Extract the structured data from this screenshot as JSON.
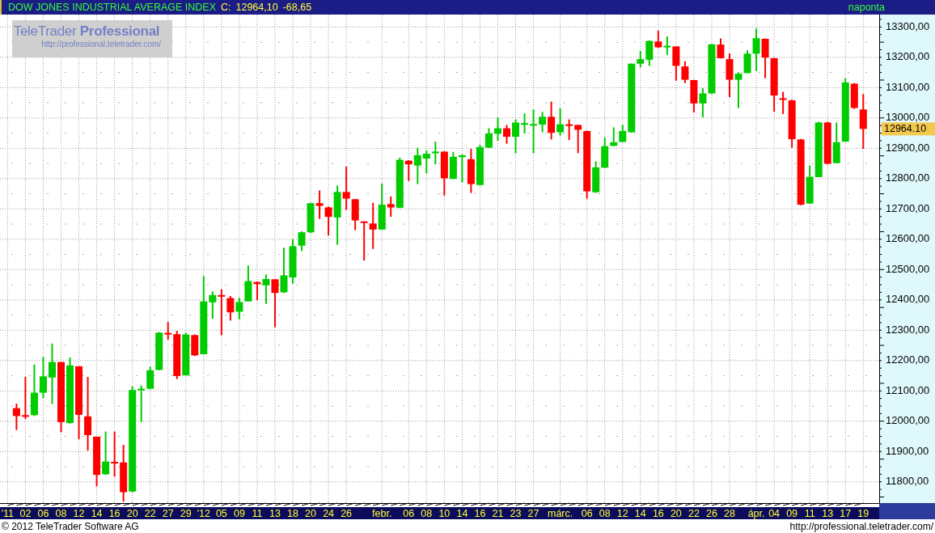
{
  "title_bar": {
    "title": "DOW JONES INDUSTRIAL AVERAGE INDEX",
    "quote_label": "C:",
    "close": "12964,10",
    "change": "-68,65",
    "interval": "naponta"
  },
  "logo": {
    "name": "TeleTrader **Professional**",
    "url": "http://professional.teletrader.com/"
  },
  "chart": {
    "last_price_label": "12964.10",
    "chart_data": {
      "type": "candlestick",
      "grid": true,
      "ylim": [
        11730,
        13341
      ],
      "categories": [
        "'11",
        null,
        "02",
        null,
        "06",
        null,
        "08",
        null,
        "12",
        null,
        "14",
        null,
        "16",
        null,
        "20",
        null,
        "22",
        null,
        "27",
        null,
        "29",
        null,
        "'12",
        null,
        "05",
        null,
        "09",
        null,
        "11",
        null,
        "13",
        null,
        "18",
        null,
        "20",
        null,
        "24",
        null,
        "26",
        null,
        null,
        null,
        "febr.",
        null,
        null,
        "06",
        null,
        "08",
        null,
        "10",
        null,
        "14",
        null,
        "16",
        null,
        "21",
        null,
        "23",
        null,
        "27",
        null,
        null,
        "márc.",
        null,
        null,
        "06",
        null,
        "08",
        null,
        "12",
        null,
        "14",
        null,
        "16",
        null,
        "20",
        null,
        "22",
        null,
        "26",
        null,
        "28",
        null,
        null,
        "ápr.",
        null,
        "04",
        null,
        "09",
        null,
        "11",
        null,
        "13",
        null,
        "17",
        null,
        "19"
      ],
      "yticks": [
        {
          "value": 13300,
          "label": "13300,00"
        },
        {
          "value": 13200,
          "label": "13200,00"
        },
        {
          "value": 13100,
          "label": "13100,00"
        },
        {
          "value": 13000,
          "label": "13000,00"
        },
        {
          "value": 12900,
          "label": "12900,00"
        },
        {
          "value": 12800,
          "label": "12800,00"
        },
        {
          "value": 12700,
          "label": "12700,00"
        },
        {
          "value": 12600,
          "label": "12600,00"
        },
        {
          "value": 12500,
          "label": "12500,00"
        },
        {
          "value": 12400,
          "label": "12400,00"
        },
        {
          "value": 12300,
          "label": "12300,00"
        },
        {
          "value": 12200,
          "label": "12200,00"
        },
        {
          "value": 12100,
          "label": "12100,00"
        },
        {
          "value": 12000,
          "label": "12000,00"
        },
        {
          "value": 11900,
          "label": "11900,00"
        },
        {
          "value": 11800,
          "label": "11800,00"
        }
      ],
      "ohlc": [
        null,
        [
          12043,
          12058,
          11971,
          12017
        ],
        [
          12020,
          12146,
          12007,
          12016
        ],
        [
          12020,
          12187,
          12017,
          12094
        ],
        [
          12094,
          12212,
          12076,
          12148
        ],
        [
          12144,
          12256,
          12057,
          12195
        ],
        [
          12195,
          12195,
          11964,
          11997
        ],
        [
          11994,
          12210,
          11992,
          12184
        ],
        [
          12181,
          12182,
          11941,
          12021
        ],
        [
          12016,
          12146,
          11903,
          11954
        ],
        [
          11949,
          11949,
          11785,
          11823
        ],
        [
          11825,
          11966,
          11823,
          11867
        ],
        [
          11866,
          11966,
          11817,
          11864
        ],
        [
          11864,
          11922,
          11735,
          11766
        ],
        [
          11768,
          12115,
          11766,
          12103
        ],
        [
          12102,
          12118,
          11997,
          12107
        ],
        [
          12107,
          12180,
          12105,
          12168
        ],
        [
          12169,
          12294,
          12168,
          12292
        ],
        [
          12291,
          12327,
          12269,
          12286
        ],
        [
          12287,
          12298,
          12139,
          12149
        ],
        [
          12151,
          12292,
          12151,
          12286
        ],
        [
          12284,
          12286,
          12215,
          12217
        ],
        [
          12221,
          12479,
          12221,
          12395
        ],
        [
          12392,
          12428,
          12338,
          12416
        ],
        [
          12416,
          12435,
          12284,
          12411
        ],
        [
          12406,
          12413,
          12332,
          12359
        ],
        [
          12361,
          12407,
          12336,
          12393
        ],
        [
          12395,
          12513,
          12395,
          12462
        ],
        [
          12459,
          12461,
          12399,
          12452
        ],
        [
          12448,
          12484,
          12387,
          12469
        ],
        [
          12468,
          12469,
          12310,
          12423
        ],
        [
          12425,
          12572,
          12423,
          12481
        ],
        [
          12474,
          12600,
          12454,
          12577
        ],
        [
          12579,
          12626,
          12561,
          12623
        ],
        [
          12623,
          12720,
          12621,
          12719
        ],
        [
          12719,
          12761,
          12667,
          12710
        ],
        [
          12705,
          12708,
          12613,
          12674
        ],
        [
          12672,
          12777,
          12582,
          12756
        ],
        [
          12756,
          12840,
          12697,
          12734
        ],
        [
          12732,
          12733,
          12630,
          12662
        ],
        [
          12659,
          12659,
          12530,
          12655
        ],
        [
          12652,
          12720,
          12568,
          12632
        ],
        [
          12632,
          12784,
          12632,
          12714
        ],
        [
          12716,
          12741,
          12674,
          12705
        ],
        [
          12704,
          12869,
          12702,
          12862
        ],
        [
          12859,
          12861,
          12792,
          12847
        ],
        [
          12843,
          12902,
          12782,
          12877
        ],
        [
          12866,
          12893,
          12817,
          12882
        ],
        [
          12884,
          12922,
          12847,
          12889
        ],
        [
          12889,
          12890,
          12744,
          12801
        ],
        [
          12799,
          12888,
          12799,
          12872
        ],
        [
          12871,
          12880,
          12787,
          12877
        ],
        [
          12864,
          12898,
          12753,
          12782
        ],
        [
          12779,
          12912,
          12777,
          12904
        ],
        [
          12902,
          12966,
          12901,
          12949
        ],
        [
          12948,
          13002,
          12925,
          12966
        ],
        [
          12966,
          12977,
          12915,
          12938
        ],
        [
          12938,
          12995,
          12884,
          12985
        ],
        [
          12978,
          13015,
          12949,
          12983
        ],
        [
          12975,
          13028,
          12884,
          12980
        ],
        [
          12978,
          13020,
          12953,
          13004
        ],
        [
          13004,
          13054,
          12929,
          12951
        ],
        [
          12953,
          13032,
          12942,
          12979
        ],
        [
          12979,
          12995,
          12927,
          12975
        ],
        [
          12977,
          12977,
          12884,
          12961
        ],
        [
          12957,
          12958,
          12734,
          12758
        ],
        [
          12755,
          12857,
          12753,
          12837
        ],
        [
          12836,
          12936,
          12835,
          12907
        ],
        [
          12908,
          12969,
          12907,
          12920
        ],
        [
          12921,
          12977,
          12920,
          12957
        ],
        [
          12953,
          13180,
          12951,
          13179
        ],
        [
          13179,
          13221,
          13167,
          13194
        ],
        [
          13192,
          13256,
          13172,
          13254
        ],
        [
          13252,
          13288,
          13231,
          13233
        ],
        [
          13234,
          13269,
          13208,
          13238
        ],
        [
          13236,
          13236,
          13123,
          13172
        ],
        [
          13170,
          13187,
          13115,
          13126
        ],
        [
          13125,
          13126,
          13018,
          13048
        ],
        [
          13048,
          13098,
          13002,
          13081
        ],
        [
          13081,
          13244,
          13079,
          13243
        ],
        [
          13242,
          13262,
          13196,
          13197
        ],
        [
          13194,
          13213,
          13069,
          13126
        ],
        [
          13126,
          13151,
          13033,
          13146
        ],
        [
          13148,
          13223,
          13148,
          13212
        ],
        [
          13212,
          13295,
          13155,
          13263
        ],
        [
          13261,
          13262,
          13131,
          13199
        ],
        [
          13197,
          13199,
          13021,
          13074
        ],
        [
          13065,
          13086,
          13013,
          13061
        ],
        [
          13058,
          13061,
          12902,
          12930
        ],
        [
          12929,
          12931,
          12712,
          12714
        ],
        [
          12718,
          12843,
          12717,
          12806
        ],
        [
          12805,
          12987,
          12805,
          12985
        ],
        [
          12985,
          12987,
          12847,
          12849
        ],
        [
          12851,
          12985,
          12851,
          12920
        ],
        [
          12922,
          13131,
          12921,
          13117
        ],
        [
          13113,
          13115,
          13030,
          13033
        ],
        [
          13028,
          13079,
          12898,
          12964
        ]
      ]
    }
  },
  "footer": {
    "copyright": "© 2012 TeleTrader Software AG",
    "url": "http://professional.teletrader.com/"
  }
}
